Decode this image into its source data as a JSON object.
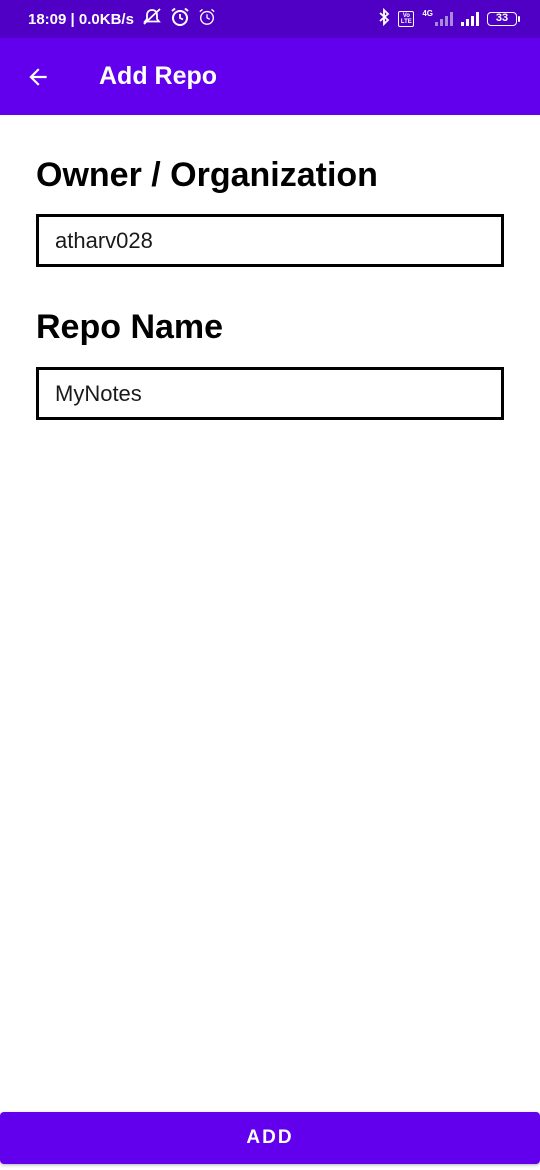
{
  "status_bar": {
    "time_and_speed": "18:09 | 0.0KB/s",
    "network_type": "4G",
    "volte_top": "Vo",
    "volte_bottom": "LTE",
    "battery_level": "33",
    "icons": [
      "mute-notifications-icon",
      "alarm-icon",
      "alarm-secondary-icon",
      "bluetooth-icon",
      "volte-icon",
      "signal-sim1-icon",
      "signal-sim2-icon",
      "battery-icon"
    ]
  },
  "app_bar": {
    "back_icon": "arrow-back-icon",
    "title": "Add Repo"
  },
  "form": {
    "owner": {
      "label": "Owner / Organization",
      "value": "atharv028"
    },
    "repo": {
      "label": "Repo Name",
      "value": "MyNotes"
    }
  },
  "actions": {
    "add_label": "ADD"
  },
  "colors": {
    "status_bar": "#4f00c4",
    "primary": "#6200ee",
    "text": "#000000",
    "background": "#ffffff"
  }
}
